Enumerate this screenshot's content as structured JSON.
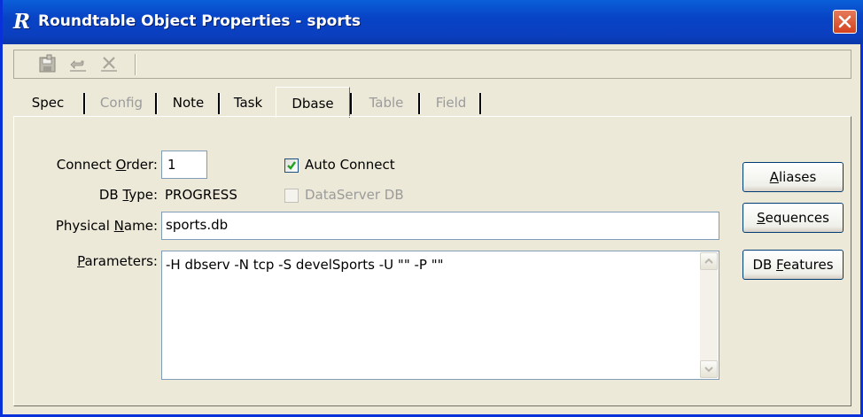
{
  "window": {
    "title": "Roundtable Object Properties - sports",
    "app_icon_letter": "R"
  },
  "toolbar": {
    "buttons": [
      "save-icon",
      "undo-icon",
      "delete-icon"
    ]
  },
  "tabs": [
    {
      "label": "Spec",
      "state": "enabled"
    },
    {
      "label": "Config",
      "state": "disabled"
    },
    {
      "label": "Note",
      "state": "enabled"
    },
    {
      "label": "Task",
      "state": "enabled"
    },
    {
      "label": "Dbase",
      "state": "active"
    },
    {
      "label": "Table",
      "state": "disabled"
    },
    {
      "label": "Field",
      "state": "disabled"
    }
  ],
  "form": {
    "connect_order": {
      "label_pre": "Connect ",
      "label_key": "O",
      "label_post": "rder:",
      "value": "1"
    },
    "db_type": {
      "label_pre": "DB ",
      "label_key": "T",
      "label_post": "ype:",
      "value": "PROGRESS"
    },
    "physical_name": {
      "label_pre": "Physical ",
      "label_key": "N",
      "label_post": "ame:",
      "value": "sports.db"
    },
    "parameters": {
      "label_pre": "",
      "label_key": "P",
      "label_post": "arameters:",
      "value": "-H dbserv -N tcp -S develSports -U \"\" -P \"\""
    },
    "auto_connect": {
      "label": "Auto Connect",
      "checked": true
    },
    "dataserver_db": {
      "label": "DataServer DB",
      "checked": false,
      "disabled": true
    }
  },
  "buttons": {
    "aliases": {
      "pre": "",
      "key": "A",
      "post": "liases"
    },
    "sequences": {
      "pre": "",
      "key": "S",
      "post": "equences"
    },
    "db_features": {
      "pre": "DB ",
      "key": "F",
      "post": "eatures"
    }
  },
  "colors": {
    "titlebar": "#0a48c8",
    "window_bg": "#ece9d8",
    "close_button": "#d4421f",
    "checkmark": "#21a121"
  }
}
